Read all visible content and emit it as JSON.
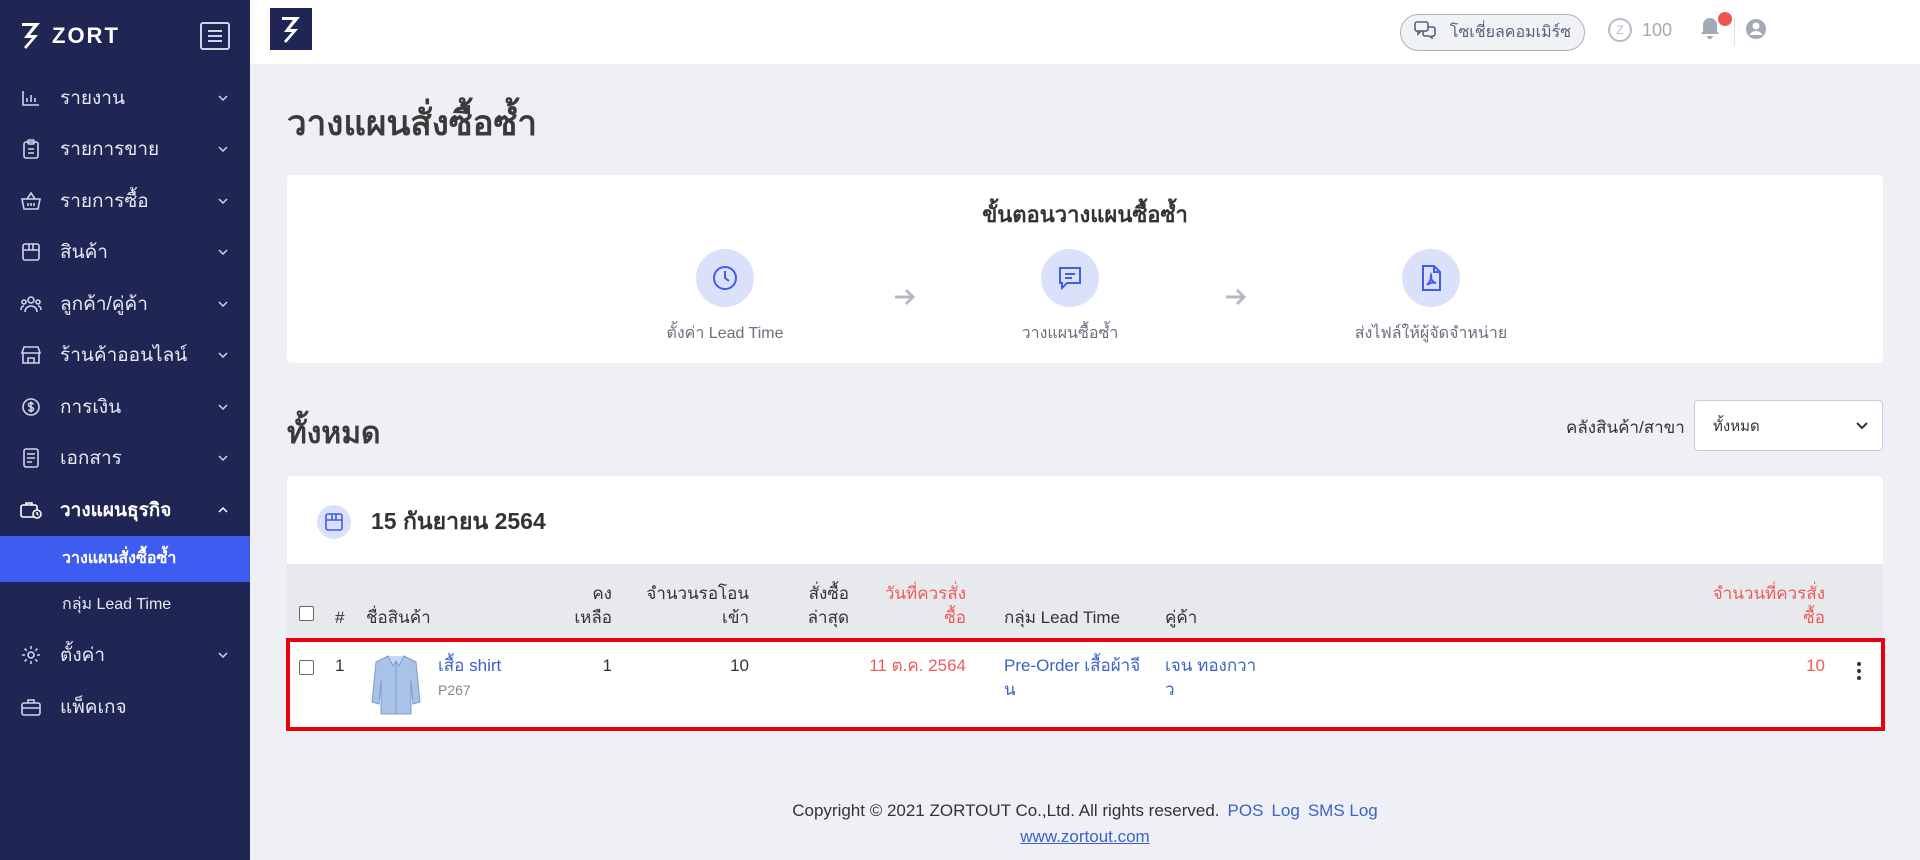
{
  "sidebar": {
    "brand": "ZORT",
    "items": [
      {
        "label": "รายงาน",
        "icon": "chart-icon"
      },
      {
        "label": "รายการขาย",
        "icon": "clipboard-icon"
      },
      {
        "label": "รายการซื้อ",
        "icon": "basket-icon"
      },
      {
        "label": "สินค้า",
        "icon": "box-icon"
      },
      {
        "label": "ลูกค้า/คู่ค้า",
        "icon": "users-icon"
      },
      {
        "label": "ร้านค้าออนไลน์",
        "icon": "store-icon"
      },
      {
        "label": "การเงิน",
        "icon": "dollar-icon"
      },
      {
        "label": "เอกสาร",
        "icon": "document-icon"
      },
      {
        "label": "วางแผนธุรกิจ",
        "icon": "planning-icon"
      }
    ],
    "sub_items": [
      {
        "label": "วางแผนสั่งซื้อซ้ำ"
      },
      {
        "label": "กลุ่ม Lead Time"
      }
    ],
    "bottom_items": [
      {
        "label": "ตั้งค่า",
        "icon": "gear-icon"
      },
      {
        "label": "แพ็คเกจ",
        "icon": "briefcase-icon"
      }
    ]
  },
  "topbar": {
    "social_label": "โซเชี่ยลคอมเมิร์ซ",
    "credit": "100"
  },
  "page": {
    "title": "วางแผนสั่งซื้อซ้ำ"
  },
  "steps": {
    "title": "ขั้นตอนวางแผนซื้อซ้ำ",
    "items": [
      {
        "label": "ตั้งค่า Lead Time",
        "icon": "clock-icon"
      },
      {
        "label": "วางแผนซื้อซ้ำ",
        "icon": "message-icon"
      },
      {
        "label": "ส่งไฟล์ให้ผู้จัดจำหน่าย",
        "icon": "pdf-file-icon"
      }
    ]
  },
  "section": {
    "title": "ทั้งหมด",
    "filter_label": "คลังสินค้า/สาขา",
    "filter_value": "ทั้งหมด"
  },
  "group": {
    "date": "15 กันยายน 2564"
  },
  "table": {
    "headers": {
      "index": "#",
      "product": "ชื่อสินค้า",
      "lead_time_group": "กลุ่ม Lead Time",
      "supplier": "คู่ค้า",
      "remaining_1": "คง",
      "remaining_2": "เหลือ",
      "pending_1": "จำนวนรอโอน",
      "pending_2": "เข้า",
      "last_order_1": "สั่งซื้อ",
      "last_order_2": "ล่าสุด",
      "order_date_1": "วันที่ควรสั่ง",
      "order_date_2": "ซื้อ",
      "order_qty_1": "จำนวนที่ควรสั่ง",
      "order_qty_2": "ซื้อ"
    },
    "rows": [
      {
        "index": "1",
        "product_name": "เสื้อ shirt",
        "sku": "P267",
        "lead_time_group_1": "Pre-Order เสื้อผ้าจี",
        "lead_time_group_2": "น",
        "supplier_1": "เจน ทองกวา",
        "supplier_2": "ว",
        "remaining": "1",
        "pending": "10",
        "last_order": "",
        "order_date": "11 ต.ค. 2564",
        "order_qty": "10"
      }
    ]
  },
  "footer": {
    "copyright": "Copyright © 2021 ZORTOUT Co.,Ltd. All rights reserved.",
    "links": [
      "POS",
      "Log",
      "SMS Log"
    ],
    "website": "www.zortout.com"
  },
  "colors": {
    "sidebar_bg": "#202654",
    "active": "#3f5cf0",
    "link": "#3c62c9",
    "alert_red": "#f05a5a",
    "highlight": "#e8000d"
  }
}
